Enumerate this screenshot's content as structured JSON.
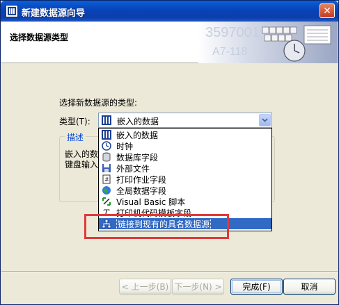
{
  "window": {
    "title": "新建数据源向导"
  },
  "header": {
    "title": "选择数据源类型"
  },
  "form": {
    "prompt": "选择新数据源的类型:",
    "type_label": "类型(T):",
    "selected_value": "嵌入的数据"
  },
  "description": {
    "legend": "描述",
    "line1": "嵌入的数",
    "line2": "键盘输入"
  },
  "dropdown": {
    "options": [
      {
        "label": "嵌入的数据",
        "icon": "embedded-data-icon"
      },
      {
        "label": "时钟",
        "icon": "clock-icon"
      },
      {
        "label": "数据库字段",
        "icon": "database-icon"
      },
      {
        "label": "外部文件",
        "icon": "floppy-disk-icon"
      },
      {
        "label": "打印作业字段",
        "icon": "print-job-icon"
      },
      {
        "label": "全局数据字段",
        "icon": "globe-icon"
      },
      {
        "label": "Visual Basic 脚本",
        "icon": "vb-script-icon"
      },
      {
        "label": "打印机代码模板字段",
        "icon": "printer-code-icon"
      },
      {
        "label": "链接到现有的具名数据源",
        "icon": "link-data-source-icon"
      }
    ],
    "selected_index": 8
  },
  "buttons": {
    "back": "< 上一步(B)",
    "next": "下一步(N) >",
    "finish": "完成(F)",
    "cancel": "取消"
  },
  "colors": {
    "title_bar": "#0842b8",
    "dialog_bg": "#ece9d8",
    "selection": "#316ac5",
    "annotation": "#e03a3a"
  }
}
